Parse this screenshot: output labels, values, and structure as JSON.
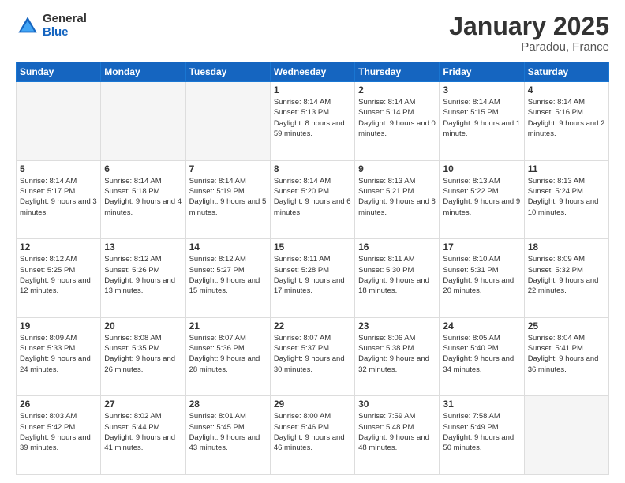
{
  "logo": {
    "general": "General",
    "blue": "Blue"
  },
  "header": {
    "title": "January 2025",
    "subtitle": "Paradou, France"
  },
  "weekdays": [
    "Sunday",
    "Monday",
    "Tuesday",
    "Wednesday",
    "Thursday",
    "Friday",
    "Saturday"
  ],
  "weeks": [
    [
      {
        "day": "",
        "sunrise": "",
        "sunset": "",
        "daylight": "",
        "empty": true
      },
      {
        "day": "",
        "sunrise": "",
        "sunset": "",
        "daylight": "",
        "empty": true
      },
      {
        "day": "",
        "sunrise": "",
        "sunset": "",
        "daylight": "",
        "empty": true
      },
      {
        "day": "1",
        "sunrise": "Sunrise: 8:14 AM",
        "sunset": "Sunset: 5:13 PM",
        "daylight": "Daylight: 8 hours and 59 minutes."
      },
      {
        "day": "2",
        "sunrise": "Sunrise: 8:14 AM",
        "sunset": "Sunset: 5:14 PM",
        "daylight": "Daylight: 9 hours and 0 minutes."
      },
      {
        "day": "3",
        "sunrise": "Sunrise: 8:14 AM",
        "sunset": "Sunset: 5:15 PM",
        "daylight": "Daylight: 9 hours and 1 minute."
      },
      {
        "day": "4",
        "sunrise": "Sunrise: 8:14 AM",
        "sunset": "Sunset: 5:16 PM",
        "daylight": "Daylight: 9 hours and 2 minutes."
      }
    ],
    [
      {
        "day": "5",
        "sunrise": "Sunrise: 8:14 AM",
        "sunset": "Sunset: 5:17 PM",
        "daylight": "Daylight: 9 hours and 3 minutes."
      },
      {
        "day": "6",
        "sunrise": "Sunrise: 8:14 AM",
        "sunset": "Sunset: 5:18 PM",
        "daylight": "Daylight: 9 hours and 4 minutes."
      },
      {
        "day": "7",
        "sunrise": "Sunrise: 8:14 AM",
        "sunset": "Sunset: 5:19 PM",
        "daylight": "Daylight: 9 hours and 5 minutes."
      },
      {
        "day": "8",
        "sunrise": "Sunrise: 8:14 AM",
        "sunset": "Sunset: 5:20 PM",
        "daylight": "Daylight: 9 hours and 6 minutes."
      },
      {
        "day": "9",
        "sunrise": "Sunrise: 8:13 AM",
        "sunset": "Sunset: 5:21 PM",
        "daylight": "Daylight: 9 hours and 8 minutes."
      },
      {
        "day": "10",
        "sunrise": "Sunrise: 8:13 AM",
        "sunset": "Sunset: 5:22 PM",
        "daylight": "Daylight: 9 hours and 9 minutes."
      },
      {
        "day": "11",
        "sunrise": "Sunrise: 8:13 AM",
        "sunset": "Sunset: 5:24 PM",
        "daylight": "Daylight: 9 hours and 10 minutes."
      }
    ],
    [
      {
        "day": "12",
        "sunrise": "Sunrise: 8:12 AM",
        "sunset": "Sunset: 5:25 PM",
        "daylight": "Daylight: 9 hours and 12 minutes."
      },
      {
        "day": "13",
        "sunrise": "Sunrise: 8:12 AM",
        "sunset": "Sunset: 5:26 PM",
        "daylight": "Daylight: 9 hours and 13 minutes."
      },
      {
        "day": "14",
        "sunrise": "Sunrise: 8:12 AM",
        "sunset": "Sunset: 5:27 PM",
        "daylight": "Daylight: 9 hours and 15 minutes."
      },
      {
        "day": "15",
        "sunrise": "Sunrise: 8:11 AM",
        "sunset": "Sunset: 5:28 PM",
        "daylight": "Daylight: 9 hours and 17 minutes."
      },
      {
        "day": "16",
        "sunrise": "Sunrise: 8:11 AM",
        "sunset": "Sunset: 5:30 PM",
        "daylight": "Daylight: 9 hours and 18 minutes."
      },
      {
        "day": "17",
        "sunrise": "Sunrise: 8:10 AM",
        "sunset": "Sunset: 5:31 PM",
        "daylight": "Daylight: 9 hours and 20 minutes."
      },
      {
        "day": "18",
        "sunrise": "Sunrise: 8:09 AM",
        "sunset": "Sunset: 5:32 PM",
        "daylight": "Daylight: 9 hours and 22 minutes."
      }
    ],
    [
      {
        "day": "19",
        "sunrise": "Sunrise: 8:09 AM",
        "sunset": "Sunset: 5:33 PM",
        "daylight": "Daylight: 9 hours and 24 minutes."
      },
      {
        "day": "20",
        "sunrise": "Sunrise: 8:08 AM",
        "sunset": "Sunset: 5:35 PM",
        "daylight": "Daylight: 9 hours and 26 minutes."
      },
      {
        "day": "21",
        "sunrise": "Sunrise: 8:07 AM",
        "sunset": "Sunset: 5:36 PM",
        "daylight": "Daylight: 9 hours and 28 minutes."
      },
      {
        "day": "22",
        "sunrise": "Sunrise: 8:07 AM",
        "sunset": "Sunset: 5:37 PM",
        "daylight": "Daylight: 9 hours and 30 minutes."
      },
      {
        "day": "23",
        "sunrise": "Sunrise: 8:06 AM",
        "sunset": "Sunset: 5:38 PM",
        "daylight": "Daylight: 9 hours and 32 minutes."
      },
      {
        "day": "24",
        "sunrise": "Sunrise: 8:05 AM",
        "sunset": "Sunset: 5:40 PM",
        "daylight": "Daylight: 9 hours and 34 minutes."
      },
      {
        "day": "25",
        "sunrise": "Sunrise: 8:04 AM",
        "sunset": "Sunset: 5:41 PM",
        "daylight": "Daylight: 9 hours and 36 minutes."
      }
    ],
    [
      {
        "day": "26",
        "sunrise": "Sunrise: 8:03 AM",
        "sunset": "Sunset: 5:42 PM",
        "daylight": "Daylight: 9 hours and 39 minutes."
      },
      {
        "day": "27",
        "sunrise": "Sunrise: 8:02 AM",
        "sunset": "Sunset: 5:44 PM",
        "daylight": "Daylight: 9 hours and 41 minutes."
      },
      {
        "day": "28",
        "sunrise": "Sunrise: 8:01 AM",
        "sunset": "Sunset: 5:45 PM",
        "daylight": "Daylight: 9 hours and 43 minutes."
      },
      {
        "day": "29",
        "sunrise": "Sunrise: 8:00 AM",
        "sunset": "Sunset: 5:46 PM",
        "daylight": "Daylight: 9 hours and 46 minutes."
      },
      {
        "day": "30",
        "sunrise": "Sunrise: 7:59 AM",
        "sunset": "Sunset: 5:48 PM",
        "daylight": "Daylight: 9 hours and 48 minutes."
      },
      {
        "day": "31",
        "sunrise": "Sunrise: 7:58 AM",
        "sunset": "Sunset: 5:49 PM",
        "daylight": "Daylight: 9 hours and 50 minutes."
      },
      {
        "day": "",
        "sunrise": "",
        "sunset": "",
        "daylight": "",
        "empty": true
      }
    ]
  ]
}
